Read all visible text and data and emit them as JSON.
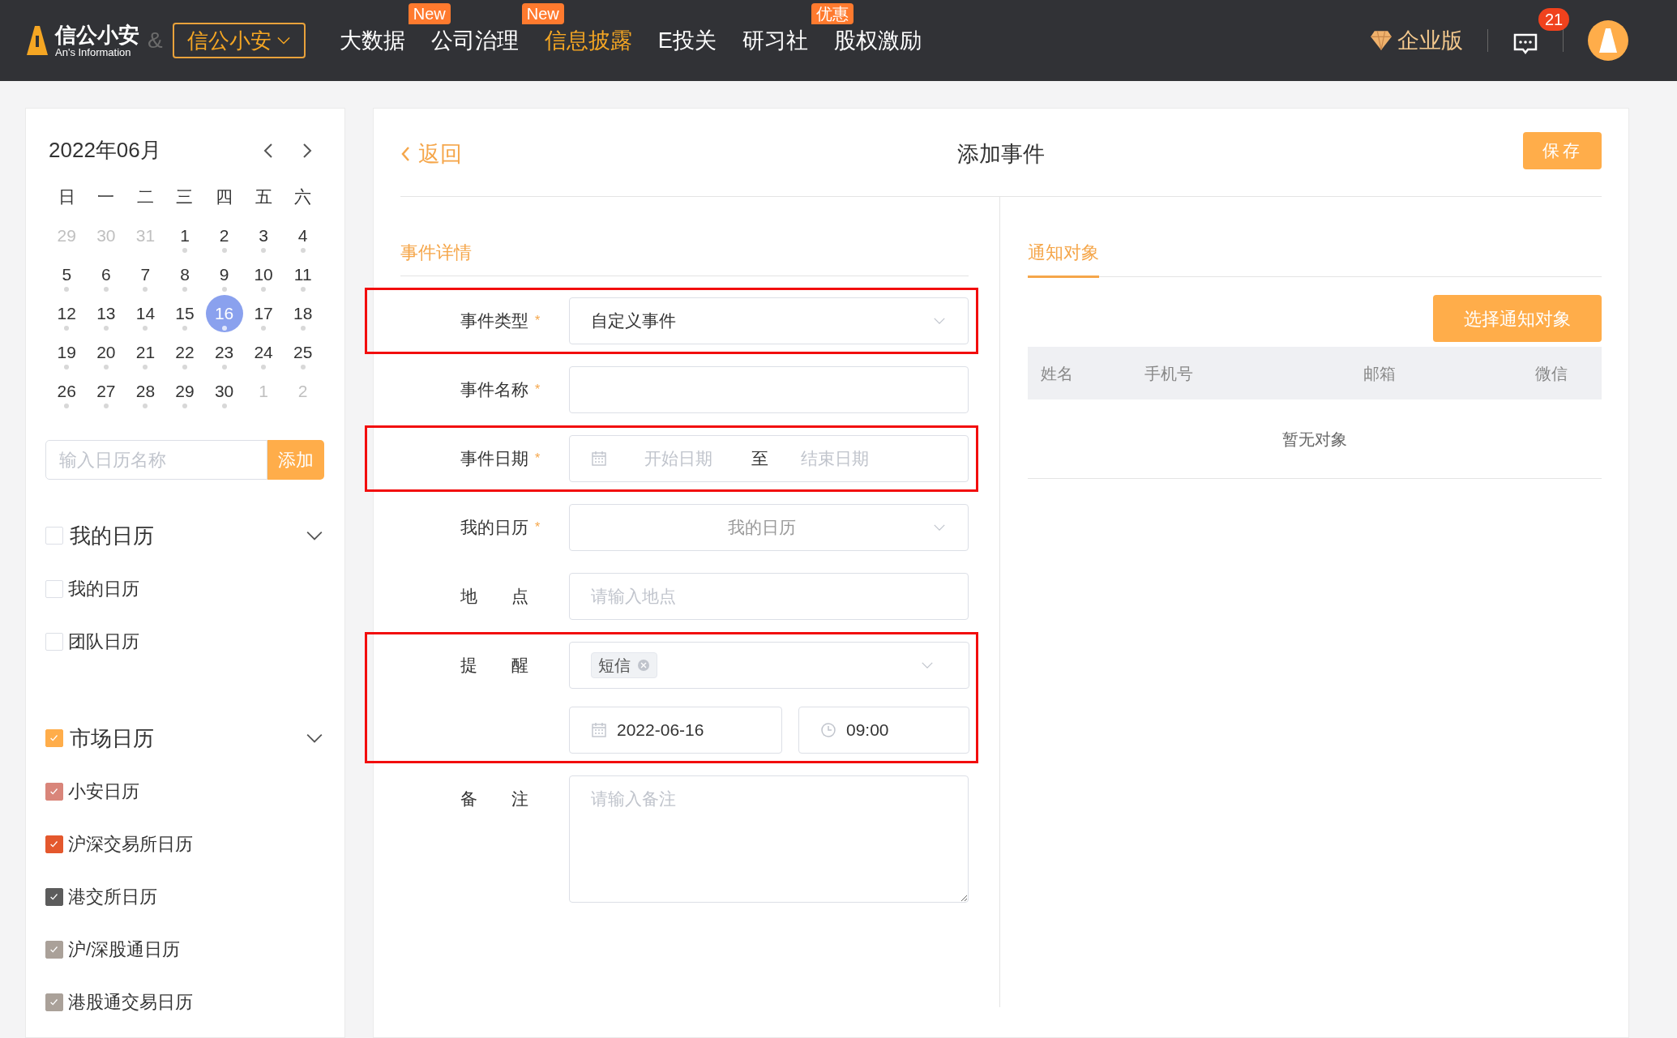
{
  "header": {
    "logo": {
      "name": "信公小安",
      "subtitle": "An's Information"
    },
    "ampersand": "&",
    "product_switch": "信公小安",
    "nav": [
      {
        "label": "大数据",
        "selected": false
      },
      {
        "label": "公司治理",
        "selected": false,
        "badge": "New"
      },
      {
        "label": "信息披露",
        "selected": true,
        "badge": "New"
      },
      {
        "label": "E投关",
        "selected": false
      },
      {
        "label": "研习社",
        "selected": false
      },
      {
        "label": "股权激励",
        "selected": false,
        "badge": "优惠"
      }
    ],
    "enterprise": "企业版",
    "messages_count": "21"
  },
  "calendar": {
    "title": "2022年06月",
    "weekdays": [
      "日",
      "一",
      "二",
      "三",
      "四",
      "五",
      "六"
    ],
    "days": [
      {
        "label": "29",
        "muted": true,
        "dot": false,
        "selected": false
      },
      {
        "label": "30",
        "muted": true,
        "dot": false,
        "selected": false
      },
      {
        "label": "31",
        "muted": true,
        "dot": false,
        "selected": false
      },
      {
        "label": "1",
        "muted": false,
        "dot": true,
        "selected": false
      },
      {
        "label": "2",
        "muted": false,
        "dot": true,
        "selected": false
      },
      {
        "label": "3",
        "muted": false,
        "dot": true,
        "selected": false
      },
      {
        "label": "4",
        "muted": false,
        "dot": true,
        "selected": false
      },
      {
        "label": "5",
        "muted": false,
        "dot": true,
        "selected": false
      },
      {
        "label": "6",
        "muted": false,
        "dot": true,
        "selected": false
      },
      {
        "label": "7",
        "muted": false,
        "dot": true,
        "selected": false
      },
      {
        "label": "8",
        "muted": false,
        "dot": true,
        "selected": false
      },
      {
        "label": "9",
        "muted": false,
        "dot": true,
        "selected": false
      },
      {
        "label": "10",
        "muted": false,
        "dot": true,
        "selected": false
      },
      {
        "label": "11",
        "muted": false,
        "dot": true,
        "selected": false
      },
      {
        "label": "12",
        "muted": false,
        "dot": true,
        "selected": false
      },
      {
        "label": "13",
        "muted": false,
        "dot": true,
        "selected": false
      },
      {
        "label": "14",
        "muted": false,
        "dot": true,
        "selected": false
      },
      {
        "label": "15",
        "muted": false,
        "dot": true,
        "selected": false
      },
      {
        "label": "16",
        "muted": false,
        "dot": true,
        "selected": true
      },
      {
        "label": "17",
        "muted": false,
        "dot": true,
        "selected": false
      },
      {
        "label": "18",
        "muted": false,
        "dot": true,
        "selected": false
      },
      {
        "label": "19",
        "muted": false,
        "dot": true,
        "selected": false
      },
      {
        "label": "20",
        "muted": false,
        "dot": true,
        "selected": false
      },
      {
        "label": "21",
        "muted": false,
        "dot": true,
        "selected": false
      },
      {
        "label": "22",
        "muted": false,
        "dot": true,
        "selected": false
      },
      {
        "label": "23",
        "muted": false,
        "dot": true,
        "selected": false
      },
      {
        "label": "24",
        "muted": false,
        "dot": true,
        "selected": false
      },
      {
        "label": "25",
        "muted": false,
        "dot": true,
        "selected": false
      },
      {
        "label": "26",
        "muted": false,
        "dot": true,
        "selected": false
      },
      {
        "label": "27",
        "muted": false,
        "dot": true,
        "selected": false
      },
      {
        "label": "28",
        "muted": false,
        "dot": true,
        "selected": false
      },
      {
        "label": "29",
        "muted": false,
        "dot": true,
        "selected": false
      },
      {
        "label": "30",
        "muted": false,
        "dot": true,
        "selected": false
      },
      {
        "label": "1",
        "muted": true,
        "dot": false,
        "selected": false
      },
      {
        "label": "2",
        "muted": true,
        "dot": false,
        "selected": false
      }
    ]
  },
  "add_calendar": {
    "placeholder": "输入日历名称",
    "button": "添加"
  },
  "calendar_groups": [
    {
      "label": "我的日历",
      "checked": false,
      "color": "#ffffff",
      "expanded": true,
      "items": [
        {
          "label": "我的日历",
          "checked": false,
          "color": "#ffffff"
        },
        {
          "label": "团队日历",
          "checked": false,
          "color": "#ffffff"
        }
      ]
    },
    {
      "label": "市场日历",
      "checked": true,
      "color": "#ffad4a",
      "expanded": true,
      "items": [
        {
          "label": "小安日历",
          "checked": true,
          "color": "#d9857a"
        },
        {
          "label": "沪深交易所日历",
          "checked": true,
          "color": "#e4582d"
        },
        {
          "label": "港交所日历",
          "checked": true,
          "color": "#5c5c5c"
        },
        {
          "label": "沪/深股通日历",
          "checked": true,
          "color": "#aaa199"
        },
        {
          "label": "港股通交易日历",
          "checked": true,
          "color": "#aaa199"
        }
      ]
    }
  ],
  "main": {
    "back": "返回",
    "title": "添加事件",
    "save": "保存",
    "details_title": "事件详情",
    "form": [
      {
        "kind": "select",
        "label": "事件类型",
        "required_mark": "*",
        "highlighted": true,
        "value": "自定义事件"
      },
      {
        "kind": "text",
        "label": "事件名称",
        "required_mark": "*",
        "highlighted": false
      },
      {
        "kind": "daterange",
        "label": "事件日期",
        "required_mark": "*",
        "highlighted": true,
        "start_placeholder": "开始日期",
        "separator": "至",
        "end_placeholder": "结束日期"
      },
      {
        "kind": "select",
        "label": "我的日历",
        "required_mark": "*",
        "highlighted": false,
        "placeholder": "我的日历"
      },
      {
        "kind": "text",
        "label": "地　　点",
        "highlighted": false,
        "placeholder": "请输入地点"
      },
      {
        "kind": "reminder",
        "label": "提　　醒",
        "highlighted": true,
        "tags": [
          "短信"
        ],
        "date": "2022-06-16",
        "time": "09:00"
      },
      {
        "kind": "textarea",
        "label": "备　　注",
        "highlighted": false,
        "placeholder": "请输入备注"
      }
    ],
    "notify": {
      "tab": "通知对象",
      "button": "选择通知对象",
      "columns": [
        "姓名",
        "手机号",
        "邮箱",
        "微信"
      ],
      "empty": "暂无对象"
    }
  }
}
